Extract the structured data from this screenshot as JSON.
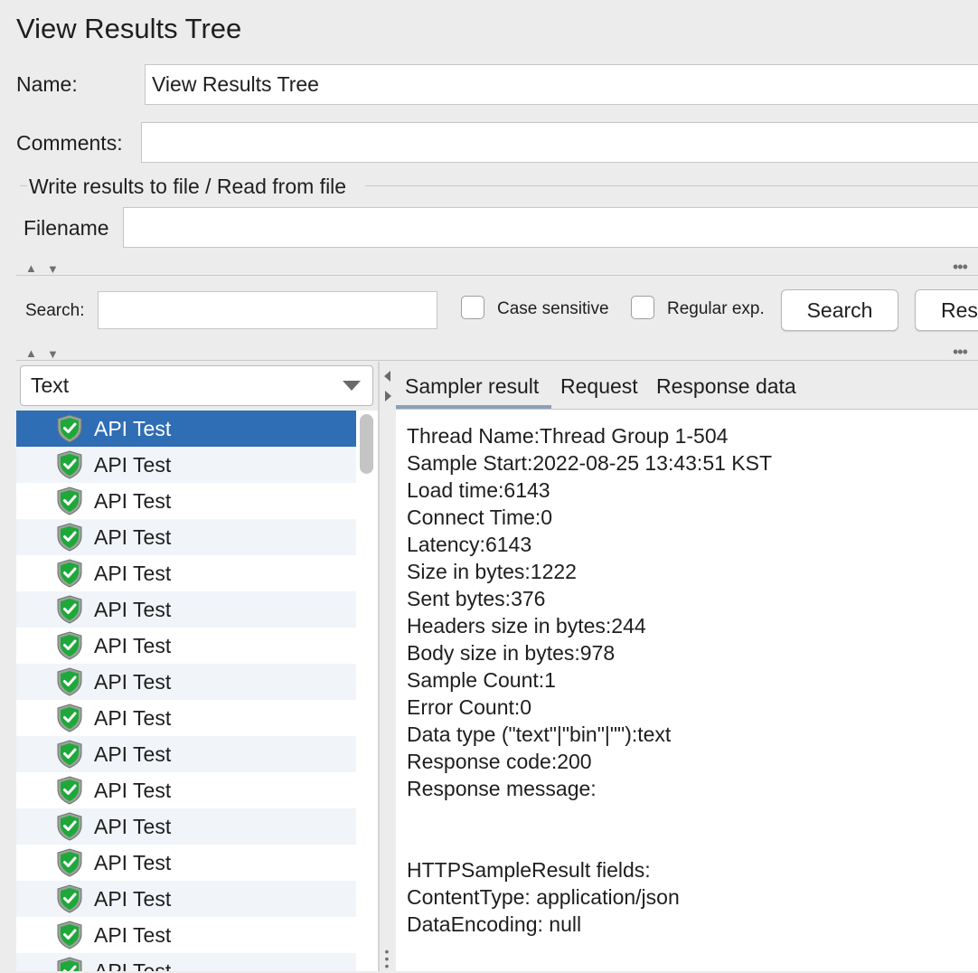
{
  "window": {
    "title": "View Results Tree"
  },
  "form": {
    "name_label": "Name:",
    "name_value": "View Results Tree",
    "comments_label": "Comments:",
    "comments_value": "",
    "file_section_legend": "Write results to file / Read from file",
    "filename_label": "Filename",
    "filename_value": ""
  },
  "search": {
    "label": "Search:",
    "value": "",
    "case_sensitive_label": "Case sensitive",
    "case_sensitive_checked": false,
    "regular_exp_label": "Regular exp.",
    "regular_exp_checked": false,
    "search_button": "Search",
    "reset_button": "Rese"
  },
  "renderer": {
    "selected": "Text"
  },
  "results": {
    "items": [
      {
        "label": "API Test",
        "status": "success"
      },
      {
        "label": "API Test",
        "status": "success"
      },
      {
        "label": "API Test",
        "status": "success"
      },
      {
        "label": "API Test",
        "status": "success"
      },
      {
        "label": "API Test",
        "status": "success"
      },
      {
        "label": "API Test",
        "status": "success"
      },
      {
        "label": "API Test",
        "status": "success"
      },
      {
        "label": "API Test",
        "status": "success"
      },
      {
        "label": "API Test",
        "status": "success"
      },
      {
        "label": "API Test",
        "status": "success"
      },
      {
        "label": "API Test",
        "status": "success"
      },
      {
        "label": "API Test",
        "status": "success"
      },
      {
        "label": "API Test",
        "status": "success"
      },
      {
        "label": "API Test",
        "status": "success"
      },
      {
        "label": "API Test",
        "status": "success"
      },
      {
        "label": "API Test",
        "status": "success"
      }
    ],
    "selected_index": 0
  },
  "tabs": [
    "Sampler result",
    "Request",
    "Response data"
  ],
  "active_tab": 0,
  "sampler_result": [
    "Thread Name:Thread Group 1-504",
    "Sample Start:2022-08-25 13:43:51 KST",
    "Load time:6143",
    "Connect Time:0",
    "Latency:6143",
    "Size in bytes:1222",
    "Sent bytes:376",
    "Headers size in bytes:244",
    "Body size in bytes:978",
    "Sample Count:1",
    "Error Count:0",
    "Data type (\"text\"|\"bin\"|\"\"):text",
    "Response code:200",
    "Response message:",
    "",
    "",
    "HTTPSampleResult fields:",
    "ContentType: application/json",
    "DataEncoding: null"
  ],
  "colors": {
    "selection": "#2f6db5",
    "success_icon": "#1fa83a",
    "window_bg": "#ececec"
  },
  "icons": {
    "collapse": "triangle-up-icon",
    "expand": "triangle-down-icon",
    "more": "more-dots-icon",
    "dropdown": "chevron-down-icon",
    "result_status": "success-shield-icon"
  }
}
